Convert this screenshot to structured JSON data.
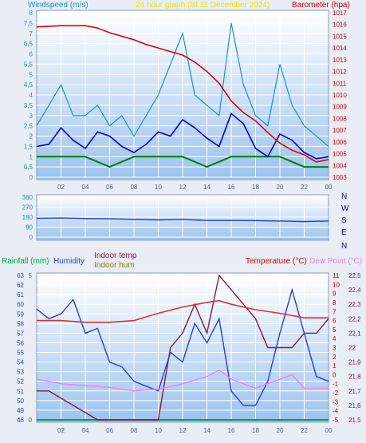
{
  "colors": {
    "wind_speed": "#1e90c8",
    "wind_avg": "#0000c8",
    "wind_green": "#008000",
    "barometer": "#e00000",
    "direction": "#1a3fc8",
    "temperature": "#e03030",
    "dew_point": "#ee82ee",
    "humidity": "#2a3fd0",
    "indoor_temp": "#8b1a3a",
    "rainfall": "#00a050"
  },
  "header": {
    "windspeed_label": "Windspeed (m/s)",
    "title_text": "24 hour graph (till 11 December 2024)",
    "barometer_label": "Barometer (hpa)"
  },
  "direction_panel": {
    "compass": [
      "N",
      "W",
      "S",
      "E",
      "N"
    ]
  },
  "bottom_panel": {
    "rainfall_label": "Rainfall (mm)",
    "humidity_label": "Humidity",
    "indoor_temp_label": "Indoor temp",
    "indoor_hum_label": "Indoor hum",
    "temperature_label": "Temperature (°C)",
    "dewpoint_label": "Dew Point (°C)"
  },
  "chart_data": [
    {
      "type": "line",
      "title": "24 hour graph (till 11 December 2024)",
      "x_ticks": [
        "02",
        "04",
        "06",
        "08",
        "10",
        "12",
        "14",
        "16",
        "18",
        "20",
        "22",
        "00"
      ],
      "left_axis": {
        "label": "Windspeed (m/s)",
        "ylim": [
          0,
          8
        ],
        "ticks": [
          "0",
          "0,5",
          "1",
          "1,5",
          "2",
          "2,5",
          "3",
          "3,5",
          "4",
          "4,5",
          "5",
          "5,5",
          "6",
          "6,5",
          "7",
          "7,5",
          "8"
        ]
      },
      "right_axis": {
        "label": "Barometer (hpa)",
        "ylim": [
          1003,
          1017
        ],
        "ticks": [
          "1003",
          "1004",
          "1005",
          "1006",
          "1007",
          "1008",
          "1009",
          "1010",
          "1011",
          "1012",
          "1013",
          "1014",
          "1015",
          "1016",
          "1017"
        ]
      },
      "series": [
        {
          "name": "Barometer (hpa)",
          "axis": "right",
          "x": [
            0,
            2,
            4,
            5,
            6,
            7,
            8,
            9,
            10,
            11,
            12,
            13,
            14,
            15,
            16,
            17,
            18,
            19,
            20,
            21,
            22,
            23,
            24
          ],
          "values": [
            1015.8,
            1015.9,
            1015.9,
            1015.7,
            1015.3,
            1015.0,
            1014.7,
            1014.3,
            1014.0,
            1013.7,
            1013.4,
            1012.8,
            1012.0,
            1011.0,
            1009.5,
            1008.5,
            1007.8,
            1006.8,
            1005.9,
            1005.3,
            1004.9,
            1004.3,
            1004.5
          ]
        },
        {
          "name": "",
          "axis": "left",
          "x": [
            0,
            1,
            2,
            3,
            4,
            5,
            6,
            7,
            8,
            9,
            10,
            11,
            12,
            13,
            14,
            15,
            16,
            17,
            18,
            19,
            20,
            21,
            22,
            23,
            24
          ],
          "values": [
            1.5,
            1.6,
            2.4,
            1.8,
            1.4,
            2.2,
            2.0,
            1.5,
            1.2,
            1.6,
            2.2,
            2.0,
            2.8,
            2.4,
            1.9,
            1.5,
            3.1,
            2.6,
            1.4,
            1.0,
            2.1,
            1.8,
            1.2,
            0.9,
            1.0
          ]
        },
        {
          "name": "",
          "axis": "left",
          "x": [
            0,
            1,
            2,
            3,
            4,
            5,
            6,
            7,
            8,
            9,
            10,
            11,
            12,
            13,
            14,
            15,
            16,
            17,
            18,
            19,
            20,
            21,
            22,
            23,
            24
          ],
          "values": [
            2.5,
            3.5,
            4.5,
            3.0,
            3.0,
            3.5,
            2.5,
            3.0,
            2.0,
            3.0,
            4.0,
            5.5,
            7.0,
            4.0,
            3.5,
            3.0,
            7.5,
            4.5,
            3.0,
            2.5,
            5.5,
            3.5,
            2.5,
            2.0,
            1.5
          ]
        },
        {
          "name": "",
          "axis": "left",
          "x": [
            0,
            2,
            4,
            6,
            8,
            10,
            12,
            14,
            16,
            18,
            20,
            22,
            24
          ],
          "values": [
            1.0,
            1.0,
            1.0,
            0.5,
            1.0,
            1.0,
            1.0,
            0.5,
            1.0,
            1.0,
            1.0,
            0.5,
            0.5
          ]
        }
      ]
    },
    {
      "type": "line",
      "x_ticks": [
        "02",
        "04",
        "06",
        "08",
        "10",
        "12",
        "14",
        "16",
        "18",
        "20",
        "22",
        "00"
      ],
      "left_axis": {
        "ylim": [
          0,
          360
        ],
        "ticks": [
          "0",
          "90",
          "180",
          "270",
          "360"
        ]
      },
      "series": [
        {
          "name": "",
          "x": [
            0,
            2,
            4,
            6,
            8,
            10,
            12,
            14,
            16,
            18,
            20,
            22,
            24
          ],
          "values": [
            170,
            172,
            168,
            165,
            160,
            155,
            160,
            150,
            150,
            148,
            145,
            140,
            145
          ]
        }
      ]
    },
    {
      "type": "line",
      "x_ticks": [
        "02",
        "04",
        "06",
        "08",
        "10",
        "12",
        "14",
        "16",
        "18",
        "20",
        "22",
        "00"
      ],
      "rain_axis": {
        "label": "Rainfall (mm)",
        "ylim": [
          0,
          5
        ],
        "ticks": [
          "0",
          "5"
        ]
      },
      "humidity_axis": {
        "label": "Humidity",
        "ylim": [
          48,
          63
        ],
        "ticks": [
          "48",
          "49",
          "50",
          "51",
          "52",
          "53",
          "54",
          "55",
          "56",
          "57",
          "58",
          "59",
          "60",
          "61",
          "62",
          "63"
        ]
      },
      "temp_axis": {
        "label": "Temperature (°C)",
        "ylim": [
          -5,
          11
        ],
        "ticks": [
          "-5",
          "-4",
          "-3",
          "-2",
          "-1",
          "0",
          "1",
          "2",
          "3",
          "4",
          "5",
          "6",
          "7",
          "8",
          "9",
          "10",
          "11"
        ]
      },
      "indoor_axis": {
        "label": "Indoor temp",
        "ylim": [
          21.5,
          22.5
        ],
        "ticks": [
          "21,5",
          "21,6",
          "21,7",
          "21,8",
          "21,9",
          "22",
          "22,1",
          "22,2",
          "22,3",
          "22,4",
          "22,5"
        ]
      },
      "series": [
        {
          "name": "Temperature (°C)",
          "axis": "temp",
          "x": [
            0,
            2,
            4,
            6,
            8,
            10,
            12,
            14,
            15,
            16,
            18,
            20,
            22,
            24
          ],
          "values": [
            6.0,
            6.0,
            5.8,
            5.8,
            6.0,
            6.8,
            7.5,
            8.0,
            8.2,
            7.8,
            7.2,
            6.8,
            6.3,
            6.3
          ]
        },
        {
          "name": "Dew Point (°C)",
          "axis": "temp",
          "x": [
            0,
            2,
            4,
            6,
            8,
            10,
            12,
            14,
            15,
            16,
            18,
            20,
            21,
            22,
            24
          ],
          "values": [
            -0.5,
            -1.0,
            -1.2,
            -1.4,
            -1.8,
            -1.6,
            -1.0,
            -0.2,
            0.5,
            -0.5,
            -1.5,
            -0.5,
            0.0,
            -1.5,
            -1.5
          ]
        },
        {
          "name": "Humidity",
          "axis": "humidity",
          "x": [
            0,
            1,
            2,
            3,
            4,
            5,
            6,
            7,
            8,
            9,
            10,
            11,
            12,
            13,
            14,
            15,
            16,
            17,
            18,
            19,
            20,
            21,
            22,
            23,
            24
          ],
          "values": [
            59.5,
            58.5,
            59.0,
            60.5,
            57.0,
            57.5,
            54.0,
            53.5,
            52.0,
            51.5,
            51.0,
            55.0,
            54.0,
            58.0,
            56.0,
            58.5,
            51.0,
            49.5,
            49.5,
            52.0,
            57.0,
            61.5,
            57.0,
            52.5,
            52.0
          ]
        },
        {
          "name": "Indoor temp",
          "axis": "indoor",
          "x": [
            0,
            1,
            2,
            3,
            4,
            5,
            6,
            7,
            8,
            9,
            10,
            11,
            12,
            13,
            14,
            15,
            16,
            17,
            18,
            19,
            20,
            21,
            22,
            23,
            24
          ],
          "values": [
            21.7,
            21.7,
            21.65,
            21.6,
            21.55,
            21.5,
            21.5,
            21.5,
            21.5,
            21.5,
            21.5,
            22.0,
            22.1,
            22.3,
            22.1,
            22.5,
            22.4,
            22.3,
            22.2,
            22.0,
            22.0,
            22.0,
            22.1,
            22.1,
            22.2
          ]
        },
        {
          "name": "Rainfall (mm)",
          "axis": "rain",
          "x": [
            0,
            24
          ],
          "values": [
            0,
            0
          ]
        }
      ]
    }
  ]
}
